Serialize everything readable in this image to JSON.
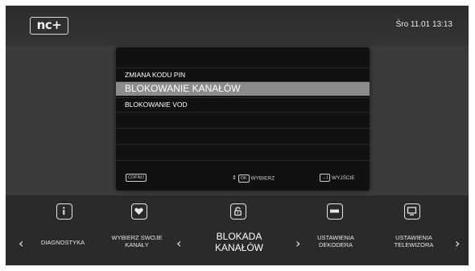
{
  "header": {
    "logo": "nc+",
    "datetime": "Śro  11.01  13:13"
  },
  "menu": {
    "items": [
      {
        "label": "ZMIANA KODU PIN"
      },
      {
        "label": "BLOKOWANIE KANAŁÓW",
        "selected": true
      },
      {
        "label": "BLOKOWANIE VOD"
      }
    ]
  },
  "hints": {
    "back_key": "COFNIJ",
    "ok_key": "OK",
    "ok_label": "WYBIERZ",
    "exit_label": "WYJŚCIE"
  },
  "carousel": {
    "items": [
      {
        "label": "DIAGNOSTYKA",
        "icon": "info-icon"
      },
      {
        "label": "WYBIERZ SWOJE KANAŁY",
        "icon": "heart-icon"
      },
      {
        "label": "BLOKADA KANAŁÓW",
        "icon": "lock-icon",
        "selected": true
      },
      {
        "label": "USTAWIENIA DEKODERA",
        "icon": "decoder-icon"
      },
      {
        "label": "USTAWIENIA TELEWIZORA",
        "icon": "tv-icon"
      }
    ]
  },
  "colors": {
    "background": "#3b3b3b",
    "panel": "#111111",
    "highlight": "#8c8c8c",
    "bottombar": "#2a2a2a"
  }
}
